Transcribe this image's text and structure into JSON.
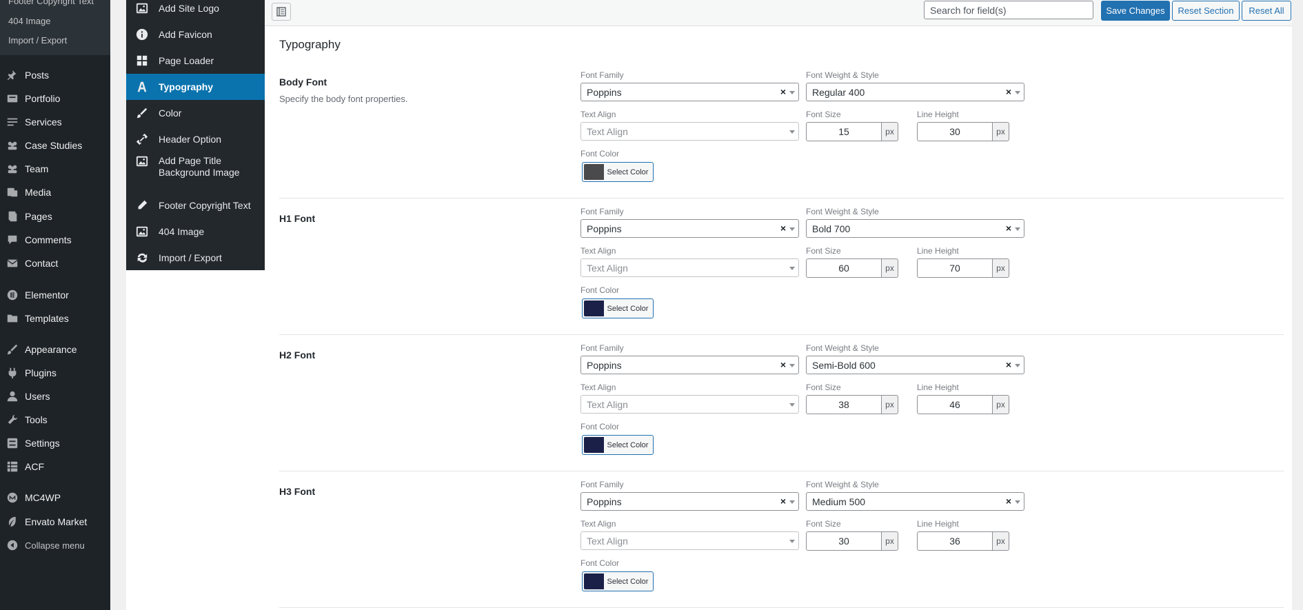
{
  "admin_submenu_top": [
    "Footer Copyright Text",
    "404 Image",
    "Import / Export"
  ],
  "admin_menu": [
    {
      "label": "Posts",
      "icon": "pushpin-icon"
    },
    {
      "label": "Portfolio",
      "icon": "portfolio-icon"
    },
    {
      "label": "Services",
      "icon": "list-icon"
    },
    {
      "label": "Case Studies",
      "icon": "groups-icon"
    },
    {
      "label": "Team",
      "icon": "groups-icon"
    },
    {
      "label": "Media",
      "icon": "media-icon"
    },
    {
      "label": "Pages",
      "icon": "pages-icon"
    },
    {
      "label": "Comments",
      "icon": "comments-icon"
    },
    {
      "label": "Contact",
      "icon": "mail-icon"
    },
    {
      "label": "Elementor",
      "icon": "elementor-icon"
    },
    {
      "label": "Templates",
      "icon": "folder-icon"
    },
    {
      "label": "Appearance",
      "icon": "brush-icon"
    },
    {
      "label": "Plugins",
      "icon": "plugin-icon"
    },
    {
      "label": "Users",
      "icon": "user-icon"
    },
    {
      "label": "Tools",
      "icon": "wrench-icon"
    },
    {
      "label": "Settings",
      "icon": "settings-icon"
    },
    {
      "label": "ACF",
      "icon": "grid-icon"
    },
    {
      "label": "MC4WP",
      "icon": "mc4wp-icon"
    },
    {
      "label": "Envato Market",
      "icon": "leaf-icon"
    },
    {
      "label": "Collapse menu",
      "icon": "collapse-icon"
    }
  ],
  "panel_sidebar": [
    {
      "label": "Add Site Logo",
      "icon": "image-icon"
    },
    {
      "label": "Add Favicon",
      "icon": "info-icon"
    },
    {
      "label": "Page Loader",
      "icon": "dashboard-icon"
    },
    {
      "label": "Typography",
      "icon": "typography-icon",
      "active": true
    },
    {
      "label": "Color",
      "icon": "brush-icon"
    },
    {
      "label": "Header Option",
      "icon": "link-icon"
    },
    {
      "label": "Add Page Title Background Image",
      "icon": "image-icon"
    },
    {
      "label": "Footer Copyright Text",
      "icon": "pencil-icon"
    },
    {
      "label": "404 Image",
      "icon": "image-icon"
    },
    {
      "label": "Import / Export",
      "icon": "refresh-icon"
    }
  ],
  "toolbar": {
    "search_placeholder": "Search for field(s)",
    "save_label": "Save Changes",
    "reset_section_label": "Reset Section",
    "reset_all_label": "Reset All"
  },
  "section_title": "Typography",
  "labels": {
    "font_family": "Font Family",
    "font_weight": "Font Weight & Style",
    "text_align": "Text Align",
    "font_size": "Font Size",
    "line_height": "Line Height",
    "font_color": "Font Color",
    "text_align_placeholder": "Text Align",
    "unit": "px",
    "select_color": "Select Color"
  },
  "fonts": [
    {
      "title": "Body Font",
      "desc": "Specify the body font properties.",
      "family": "Poppins",
      "weight": "Regular 400",
      "size": "15",
      "line_height": "30",
      "color": "#4a4a4c"
    },
    {
      "title": "H1 Font",
      "desc": "",
      "family": "Poppins",
      "weight": "Bold 700",
      "size": "60",
      "line_height": "70",
      "color": "#1b2048"
    },
    {
      "title": "H2 Font",
      "desc": "",
      "family": "Poppins",
      "weight": "Semi-Bold 600",
      "size": "38",
      "line_height": "46",
      "color": "#1b2048"
    },
    {
      "title": "H3 Font",
      "desc": "",
      "family": "Poppins",
      "weight": "Medium 500",
      "size": "30",
      "line_height": "36",
      "color": "#1b2048"
    }
  ]
}
